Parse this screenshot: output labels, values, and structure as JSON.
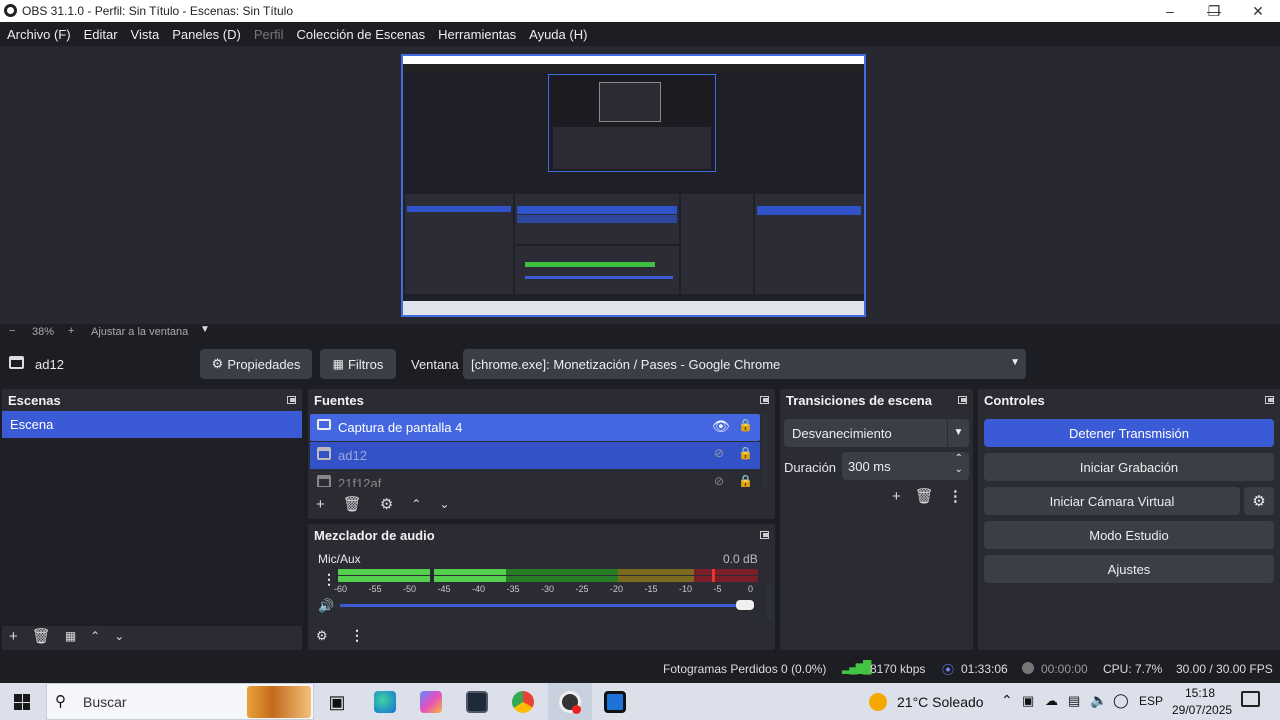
{
  "titlebar": {
    "title": "OBS 31.1.0 - Perfil: Sin Título - Escenas: Sin Título"
  },
  "menu": [
    {
      "label": "Archivo (F)",
      "disabled": false
    },
    {
      "label": "Editar",
      "disabled": false
    },
    {
      "label": "Vista",
      "disabled": false
    },
    {
      "label": "Paneles (D)",
      "disabled": false
    },
    {
      "label": "Perfil",
      "disabled": true
    },
    {
      "label": "Colección de Escenas",
      "disabled": false
    },
    {
      "label": "Herramientas",
      "disabled": false
    },
    {
      "label": "Ayuda (H)",
      "disabled": false
    }
  ],
  "zoom": {
    "minus": "−",
    "value": "38%",
    "plus": "+",
    "fit": "Ajustar a la ventana"
  },
  "sourcebar": {
    "source_name": "ad12",
    "properties": "Propiedades",
    "filters": "Filtros",
    "window_label": "Ventana",
    "window_value": "[chrome.exe]: Monetización / Pases - Google Chrome"
  },
  "scenes": {
    "title": "Escenas",
    "items": [
      "Escena"
    ]
  },
  "sources": {
    "title": "Fuentes",
    "items": [
      {
        "label": "Captura de pantalla 4",
        "visible": true
      },
      {
        "label": "ad12",
        "visible": false
      },
      {
        "label": "21f12af",
        "visible": false
      }
    ]
  },
  "mixer": {
    "title": "Mezclador de audio",
    "channel": "Mic/Aux",
    "level": "0.0 dB",
    "ticks": [
      "-60",
      "-55",
      "-50",
      "-45",
      "-40",
      "-35",
      "-30",
      "-25",
      "-20",
      "-15",
      "-10",
      "-5",
      "0"
    ],
    "volume_fraction": 1.0
  },
  "transitions": {
    "title": "Transiciones de escena",
    "type": "Desvanecimiento",
    "duration_label": "Duración",
    "duration_value": "300 ms"
  },
  "controls": {
    "title": "Controles",
    "stop_stream": "Detener Transmisión",
    "start_record": "Iniciar Grabación",
    "virtual_cam": "Iniciar Cámara Virtual",
    "studio_mode": "Modo Estudio",
    "settings": "Ajustes"
  },
  "status": {
    "dropped": "Fotogramas Perdidos 0 (0.0%)",
    "bitrate": "8170 kbps",
    "stream_time": "01:33:06",
    "rec_time": "00:00:00",
    "cpu": "CPU: 7.7%",
    "fps": "30.00 / 30.00 FPS"
  },
  "taskbar": {
    "search": "Buscar",
    "weather": "21°C  Soleado",
    "lang": "ESP",
    "time": "15:18",
    "date": "29/07/2025"
  },
  "colors": {
    "accent": "#3b5bd6",
    "panel": "#2a2b33",
    "background": "#1d1e24"
  }
}
